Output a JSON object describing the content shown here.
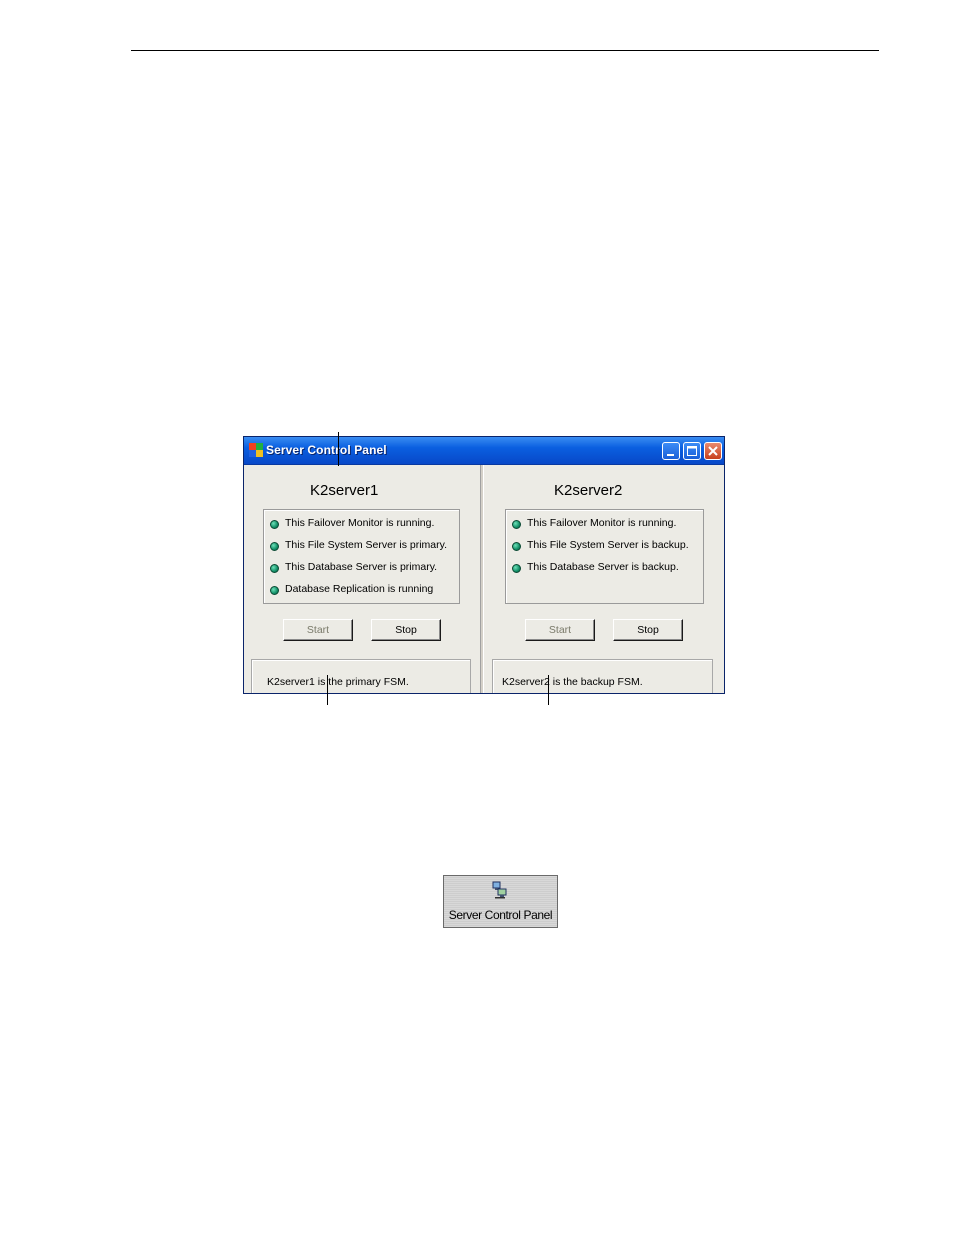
{
  "window": {
    "title": "Server Control Panel"
  },
  "panels": [
    {
      "server_name": "K2server1",
      "status": [
        "This Failover Monitor is running.",
        "This File System Server is primary.",
        "This Database Server is primary.",
        "Database Replication is running"
      ],
      "start_label": "Start",
      "stop_label": "Stop",
      "message": "K2server1 is the primary FSM."
    },
    {
      "server_name": "K2server2",
      "status": [
        "This Failover Monitor is running.",
        "This File System Server is backup.",
        "This Database Server is backup."
      ],
      "start_label": "Start",
      "stop_label": "Stop",
      "message": "K2server2 is the backup FSM."
    }
  ],
  "desktop_button": {
    "label": "Server Control Panel",
    "icon": "network-computers-icon"
  },
  "colors": {
    "titlebar": "#0a5fe0",
    "status_led": "#129068",
    "window_bg": "#ecebe5"
  }
}
